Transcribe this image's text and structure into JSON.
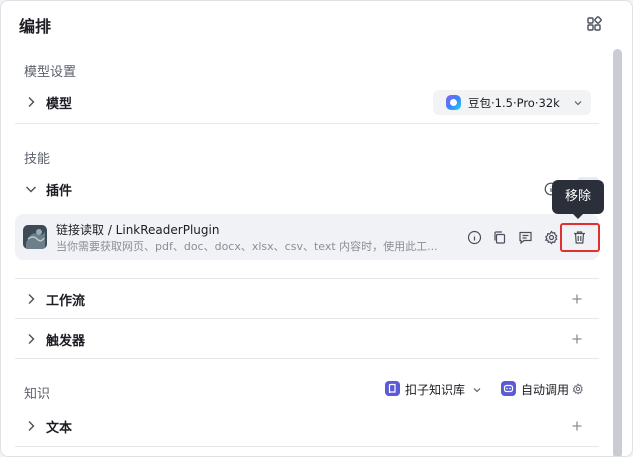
{
  "header": {
    "title": "编排",
    "layout_icon": "layout-grid-icon"
  },
  "model_settings": {
    "section_label": "模型设置",
    "row_title": "模型",
    "selected_model": "豆包·1.5·Pro·32k"
  },
  "skills": {
    "section_label": "技能",
    "plugins": {
      "title": "插件",
      "items": [
        {
          "name": "链接读取 / LinkReaderPlugin",
          "description": "当你需要获取网页、pdf、doc、docx、xlsx、csv、text 内容时，使用此工..."
        }
      ],
      "tooltip": "移除"
    },
    "workflow": {
      "title": "工作流"
    },
    "trigger": {
      "title": "触发器"
    }
  },
  "knowledge": {
    "section_label": "知识",
    "kb_chip": "扣子知识库",
    "auto_call": "自动调用",
    "text": {
      "title": "文本"
    }
  },
  "colors": {
    "accent": "#5b5bd6",
    "highlight": "#e03131",
    "tooltip_bg": "#2b2f3a"
  }
}
